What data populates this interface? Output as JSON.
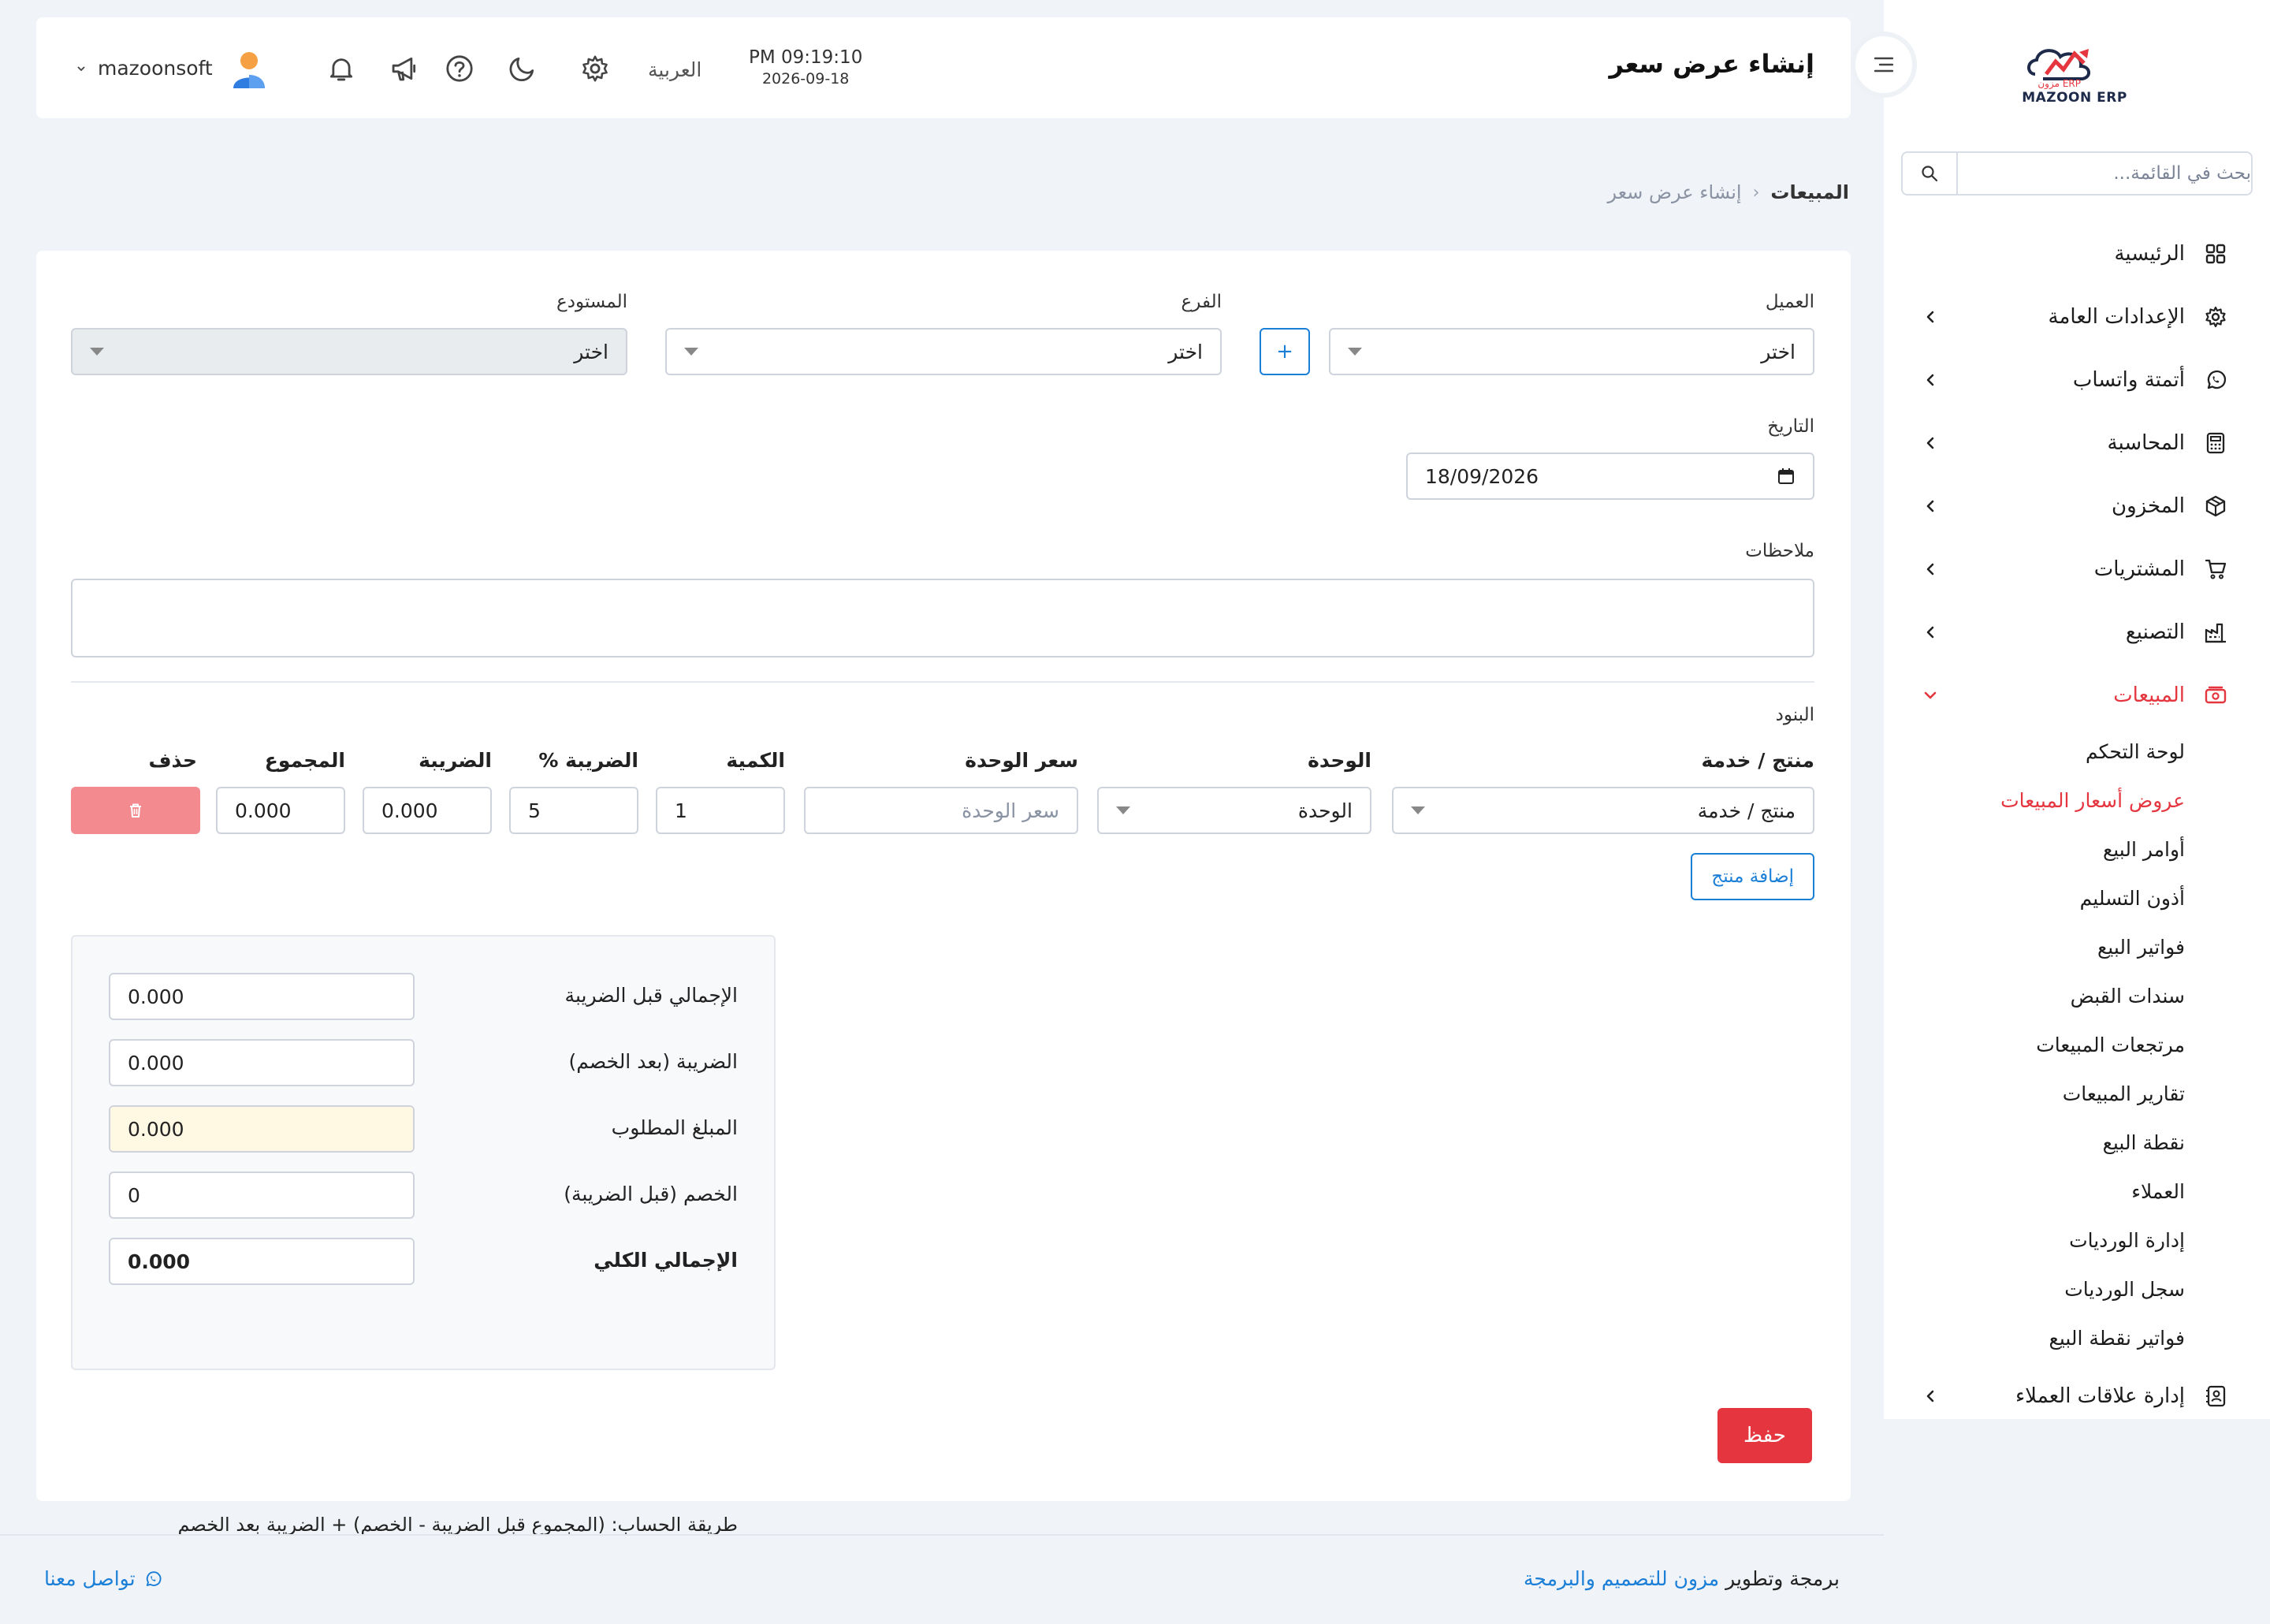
{
  "app": {
    "logo_text": "MAZOON ERP",
    "logo_subtext": "ERP مزون"
  },
  "sidebar": {
    "search_placeholder": "بحث في القائمة...",
    "items": [
      {
        "label": "الرئيسية",
        "icon": "dashboard-grid-icon",
        "expandable": false
      },
      {
        "label": "الإعدادات العامة",
        "icon": "gear-icon",
        "expandable": true
      },
      {
        "label": "أتمتة واتساب",
        "icon": "whatsapp-icon",
        "expandable": true
      },
      {
        "label": "المحاسبة",
        "icon": "calculator-icon",
        "expandable": true
      },
      {
        "label": "المخزون",
        "icon": "box-icon",
        "expandable": true
      },
      {
        "label": "المشتريات",
        "icon": "cart-icon",
        "expandable": true
      },
      {
        "label": "التصنيع",
        "icon": "factory-icon",
        "expandable": true
      },
      {
        "label": "المبيعات",
        "icon": "sales-icon",
        "expandable": true,
        "active": true
      },
      {
        "label": "إدارة علاقات العملاء",
        "icon": "contacts-icon",
        "expandable": true
      }
    ],
    "sales_subitems": [
      {
        "label": "لوحة التحكم"
      },
      {
        "label": "عروض أسعار المبيعات",
        "active": true
      },
      {
        "label": "أوامر البيع"
      },
      {
        "label": "أذون التسليم"
      },
      {
        "label": "فواتير البيع"
      },
      {
        "label": "سندات القبض"
      },
      {
        "label": "مرتجعات المبيعات"
      },
      {
        "label": "تقارير المبيعات"
      },
      {
        "label": "نقطة البيع"
      },
      {
        "label": "العملاء"
      },
      {
        "label": "إدارة الورديات"
      },
      {
        "label": "سجل الورديات"
      },
      {
        "label": "فواتير نقطة البيع"
      }
    ]
  },
  "topbar": {
    "page_title": "إنشاء عرض سعر",
    "time": "PM 09:19:10",
    "date": "2026-09-18",
    "language": "العربية",
    "username": "mazoonsoft"
  },
  "breadcrumb": {
    "root": "المبيعات",
    "current": "إنشاء عرض سعر"
  },
  "form": {
    "customer_label": "العميل",
    "customer_value": "اختر",
    "branch_label": "الفرع",
    "branch_value": "اختر",
    "warehouse_label": "المستودع",
    "warehouse_value": "اختر",
    "add_customer_label": "+",
    "date_label": "التاريخ",
    "date_value": "18/09/2026",
    "notes_label": "ملاحظات",
    "notes_value": ""
  },
  "items": {
    "section_label": "البنود",
    "columns": {
      "product": "منتج / خدمة",
      "unit": "الوحدة",
      "unit_price": "سعر الوحدة",
      "quantity": "الكمية",
      "tax_percent": "الضريبة %",
      "tax": "الضريبة",
      "total": "المجموع",
      "delete": "حذف"
    },
    "row": {
      "product": "منتج / خدمة",
      "unit": "الوحدة",
      "unit_price_placeholder": "سعر الوحدة",
      "quantity": "1",
      "tax_percent": "5",
      "tax": "0.000",
      "total": "0.000"
    },
    "add_product_label": "إضافة منتج"
  },
  "totals": {
    "subtotal_label": "الإجمالي قبل الضريبة",
    "subtotal_value": "0.000",
    "tax_after_discount_label": "الضريبة (بعد الخصم)",
    "tax_after_discount_value": "0.000",
    "amount_due_label": "المبلغ المطلوب",
    "amount_due_value": "0.000",
    "discount_label": "الخصم (قبل الضريبة)",
    "discount_value": "0",
    "grand_total_label": "الإجمالي الكلي",
    "grand_total_value": "0.000",
    "formula": "طريقة الحساب: (المجموع قبل الضريبة - الخصم) + الضريبة بعد الخصم"
  },
  "actions": {
    "save_label": "حفظ"
  },
  "footer": {
    "credit_prefix": "برمجة وتطوير",
    "credit_link": "مزون للتصميم والبرمجة",
    "contact_label": "تواصل معنا"
  },
  "colors": {
    "accent_red": "#e5363f",
    "link_blue": "#1b7fd8",
    "background": "#f0f3f7"
  }
}
